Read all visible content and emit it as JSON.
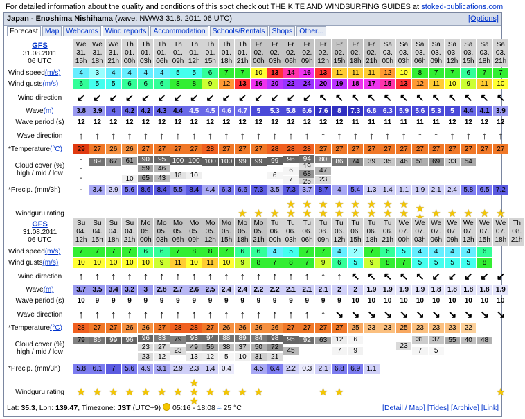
{
  "top_note": {
    "text": "For detailed information about the quality and conditions of this spot check out THE KITE AND WINDSURFING GUIDES at",
    "link": "stoked-publications.com"
  },
  "title": {
    "spot": "Japan - Enoshima Nishihama",
    "wave_info": "(wave: NWW3 31.8. 2011 06 UTC)",
    "options": "[Options]"
  },
  "tabs": [
    "Forecast",
    "Map",
    "Webcams",
    "Wind reports",
    "Accommodation",
    "Schools/Rentals",
    "Shops",
    "Other..."
  ],
  "labels": {
    "model": "GFS",
    "model_date": "31.08.2011",
    "model_time": "06 UTC",
    "wind_speed": "Wind speed",
    "wind_gusts": "Wind gusts",
    "unit_ms": "(m/s)",
    "wind_direction": "Wind direction",
    "wave": "Wave",
    "unit_m": "(m)",
    "wave_period": "Wave period (s)",
    "wave_direction": "Wave direction",
    "temperature": "*Temperature",
    "unit_c": "(°C)",
    "cloud_cover": "Cloud cover (%)",
    "cloud_sub": "high / mid / low",
    "precip": "*Precip. (mm/3h)",
    "windguru": "Windguru rating"
  },
  "colors": {
    "temp_orange": "#f07020",
    "temp_red": "#e04a1a",
    "cloud_grey": "#808080",
    "precip_blue": "#7c7cf0",
    "wave_blue": "#5a5ae0",
    "star": "#f5c700"
  },
  "blocks": [
    {
      "days": [
        "We",
        "We",
        "We",
        "Th",
        "Th",
        "Th",
        "Th",
        "Th",
        "Th",
        "Th",
        "Th",
        "Fr",
        "Fr",
        "Fr",
        "Fr",
        "Fr",
        "Fr",
        "Fr",
        "Fr",
        "Sa",
        "Sa",
        "Sa",
        "Sa",
        "Sa",
        "Sa",
        "Sa",
        "Sa"
      ],
      "dates": [
        "31.",
        "31.",
        "31.",
        "01.",
        "01.",
        "01.",
        "01.",
        "01.",
        "01.",
        "01.",
        "01.",
        "02.",
        "02.",
        "02.",
        "02.",
        "02.",
        "02.",
        "02.",
        "02.",
        "03.",
        "03.",
        "03.",
        "03.",
        "03.",
        "03.",
        "03.",
        "03."
      ],
      "hours": [
        "15h",
        "18h",
        "21h",
        "00h",
        "03h",
        "06h",
        "09h",
        "12h",
        "15h",
        "18h",
        "21h",
        "00h",
        "03h",
        "06h",
        "09h",
        "12h",
        "15h",
        "18h",
        "21h",
        "00h",
        "03h",
        "06h",
        "09h",
        "12h",
        "15h",
        "18h",
        "21h"
      ],
      "wind_speed": [
        4,
        3,
        4,
        4,
        4,
        4,
        5,
        5,
        6,
        7,
        7,
        10,
        13,
        14,
        16,
        13,
        11,
        11,
        11,
        12,
        10,
        8,
        7,
        7,
        6,
        7,
        7
      ],
      "wind_gusts": [
        6,
        5,
        5,
        6,
        6,
        6,
        8,
        8,
        9,
        12,
        13,
        16,
        20,
        22,
        24,
        20,
        19,
        18,
        17,
        15,
        13,
        12,
        11,
        10,
        9,
        11,
        10
      ],
      "wind_dir_arrows": [
        "↙",
        "↙",
        "↙",
        "↙",
        "↙",
        "↙",
        "↙",
        "↙",
        "↙",
        "↙",
        "↙",
        "↙",
        "↙",
        "↙",
        "↙",
        "↖",
        "↖",
        "↖",
        "↖",
        "↖",
        "↖",
        "↖",
        "↖",
        "↖",
        "↖",
        "↖",
        "↖"
      ],
      "wave": [
        3.8,
        3.9,
        4,
        4.2,
        4.2,
        4.3,
        4.4,
        4.5,
        4.5,
        4.6,
        4.7,
        5,
        5.3,
        5.8,
        6.6,
        7.6,
        8,
        7.3,
        6.8,
        6.3,
        5.9,
        5.6,
        5.3,
        5,
        4.4,
        4.1,
        3.9
      ],
      "wave_period": [
        12,
        12,
        12,
        12,
        12,
        12,
        12,
        12,
        12,
        12,
        12,
        12,
        12,
        12,
        12,
        12,
        12,
        11,
        11,
        11,
        11,
        11,
        11,
        12,
        12,
        12,
        12
      ],
      "wave_dir_arrows": [
        "↑",
        "↑",
        "↑",
        "↑",
        "↑",
        "↑",
        "↑",
        "↑",
        "↑",
        "↑",
        "↑",
        "↑",
        "↑",
        "↑",
        "↑",
        "↑",
        "↑",
        "↑",
        "↑",
        "↑",
        "↑",
        "↑",
        "↑",
        "↑",
        "↑",
        "↑",
        "↑"
      ],
      "temperature": [
        29,
        27,
        26,
        26,
        27,
        27,
        27,
        27,
        28,
        27,
        27,
        27,
        28,
        28,
        28,
        27,
        27,
        27,
        27,
        27,
        27,
        27,
        27,
        27,
        27,
        27,
        27
      ],
      "cloud_total": [
        "-",
        "89",
        "67",
        "61",
        "90",
        "95",
        "100",
        "100",
        "100",
        "100",
        "99",
        "99",
        "99",
        "96",
        "94",
        "80",
        "86",
        "74",
        "39",
        "35",
        "46",
        "51",
        "69",
        "33",
        "54"
      ],
      "cloud_hml": [
        [
          "-",
          "-",
          ""
        ],
        [
          "",
          "",
          ""
        ],
        [
          "",
          "",
          ""
        ],
        [
          "",
          "",
          "10"
        ],
        [
          "59",
          "65",
          ""
        ],
        [
          "46",
          "43",
          ""
        ],
        [
          "",
          "18",
          ""
        ],
        [
          "",
          "10",
          ""
        ],
        [
          "",
          "",
          ""
        ],
        [
          "",
          "",
          ""
        ],
        [
          "",
          "",
          ""
        ],
        [
          "",
          "",
          ""
        ],
        [
          "",
          "6",
          ""
        ],
        [
          "",
          "6",
          "7"
        ],
        [
          "19",
          "68",
          "25"
        ],
        [
          "",
          "47",
          "23"
        ],
        [
          "",
          "",
          ""
        ],
        [
          "",
          "",
          ""
        ],
        [
          "",
          "",
          ""
        ],
        [
          "",
          "",
          ""
        ],
        [
          "",
          "",
          ""
        ],
        [
          "",
          "",
          ""
        ],
        [
          "",
          "",
          ""
        ],
        [
          "",
          "",
          ""
        ],
        [
          "",
          "",
          ""
        ],
        [
          "",
          "",
          ""
        ],
        [
          "",
          "",
          ""
        ]
      ],
      "precip": [
        "-",
        3.4,
        2.9,
        5.6,
        8.6,
        8.4,
        5.5,
        8.4,
        4.4,
        6.3,
        6.6,
        7.3,
        3.5,
        7.3,
        3.7,
        8.7,
        4,
        5.4,
        1.3,
        1.4,
        1.1,
        1.9,
        2.1,
        2.4,
        5.8,
        6.5,
        7.2
      ],
      "stars": [
        0,
        0,
        0,
        0,
        0,
        0,
        0,
        0,
        0,
        0,
        1,
        1,
        1,
        3,
        3,
        3,
        3,
        3,
        3,
        3,
        3,
        2,
        1,
        1,
        1,
        1,
        1
      ]
    },
    {
      "days": [
        "Su",
        "Su",
        "Su",
        "Su",
        "Mo",
        "Mo",
        "Mo",
        "Mo",
        "Mo",
        "Mo",
        "Mo",
        "Mo",
        "Tu",
        "Tu",
        "Tu",
        "Tu",
        "Tu",
        "Tu",
        "Tu",
        "Tu",
        "We",
        "We",
        "We",
        "We",
        "We",
        "We",
        "We",
        "Th"
      ],
      "dates": [
        "04.",
        "04.",
        "04.",
        "04.",
        "05.",
        "05.",
        "05.",
        "05.",
        "05.",
        "05.",
        "05.",
        "05.",
        "06.",
        "06.",
        "06.",
        "06.",
        "06.",
        "06.",
        "06.",
        "06.",
        "07.",
        "07.",
        "07.",
        "07.",
        "07.",
        "07.",
        "07.",
        "08."
      ],
      "hours": [
        "12h",
        "15h",
        "18h",
        "21h",
        "00h",
        "03h",
        "06h",
        "09h",
        "12h",
        "15h",
        "18h",
        "21h",
        "00h",
        "03h",
        "06h",
        "09h",
        "12h",
        "15h",
        "18h",
        "21h",
        "00h",
        "03h",
        "06h",
        "09h",
        "12h",
        "15h",
        "18h",
        "21h"
      ],
      "wind_speed": [
        7,
        7,
        7,
        7,
        6,
        6,
        7,
        8,
        8,
        7,
        6,
        6,
        4,
        5,
        7,
        7,
        4,
        2,
        7,
        6,
        5,
        4,
        4,
        4,
        4,
        6
      ],
      "wind_gusts": [
        10,
        10,
        10,
        10,
        10,
        9,
        11,
        10,
        11,
        10,
        9,
        8,
        7,
        8,
        7,
        9,
        6,
        5,
        9,
        8,
        7,
        5,
        5,
        5,
        5,
        8
      ],
      "wind_dir_arrows": [
        "↑",
        "↑",
        "↑",
        "↑",
        "↑",
        "↑",
        "↑",
        "↑",
        "↑",
        "↑",
        "↑",
        "↑",
        "↑",
        "↑",
        "↑",
        "↑",
        "↑",
        "↖",
        "↖",
        "↖",
        "↖",
        "↖",
        "↙",
        "↙",
        "↙",
        "↙",
        "↙"
      ],
      "wave": [
        3.7,
        3.5,
        3.4,
        3.2,
        3,
        2.8,
        2.7,
        2.6,
        2.5,
        2.4,
        2.4,
        2.2,
        2.2,
        2.1,
        2.1,
        2.1,
        2,
        2,
        1.9,
        1.9,
        1.9,
        1.9,
        1.8,
        1.8,
        1.8,
        1.8,
        1.9
      ],
      "wave_period": [
        10,
        9,
        9,
        9,
        9,
        9,
        9,
        9,
        9,
        9,
        9,
        9,
        9,
        9,
        9,
        9,
        9,
        10,
        10,
        10,
        10,
        10,
        10,
        10,
        10,
        10,
        10
      ],
      "wave_dir_arrows": [
        "↑",
        "↑",
        "↑",
        "↑",
        "↑",
        "↑",
        "↑",
        "↑",
        "↑",
        "↑",
        "↑",
        "↑",
        "↑",
        "↑",
        "↑",
        "↑",
        "↘",
        "↘",
        "↘",
        "↘",
        "↘",
        "↘",
        "↘",
        "↘",
        "↘",
        "↘",
        "↘"
      ],
      "temperature": [
        28,
        27,
        27,
        26,
        26,
        27,
        28,
        28,
        27,
        26,
        26,
        26,
        26,
        27,
        27,
        27,
        27,
        25,
        23,
        23,
        25,
        23,
        23,
        23,
        22
      ],
      "cloud_total": [
        "79",
        "86",
        "99",
        "96",
        "96",
        "83",
        "79",
        "93",
        "94",
        "88",
        "89",
        "84",
        "98",
        "95",
        "92",
        "63",
        "12",
        "6",
        "",
        "",
        "",
        "31",
        "37",
        "55",
        "40",
        "48"
      ],
      "cloud_hml": [
        [
          "",
          "",
          ""
        ],
        [
          "",
          "",
          ""
        ],
        [
          "",
          "",
          ""
        ],
        [
          "",
          "",
          ""
        ],
        [
          "23",
          "23",
          ""
        ],
        [
          "27",
          "12",
          ""
        ],
        [
          "23",
          "",
          ""
        ],
        [
          "49",
          "13",
          ""
        ],
        [
          "56",
          "12",
          ""
        ],
        [
          "38",
          "5",
          ""
        ],
        [
          "37",
          "10",
          ""
        ],
        [
          "50",
          "31",
          ""
        ],
        [
          "72",
          "21",
          ""
        ],
        [
          "45",
          "",
          ""
        ],
        [
          "",
          "",
          ""
        ],
        [
          "",
          "",
          ""
        ],
        [
          "7",
          "",
          ""
        ],
        [
          "9",
          "",
          ""
        ],
        [
          "",
          "",
          ""
        ],
        [
          "",
          "",
          ""
        ],
        [
          "23",
          "",
          ""
        ],
        [
          "7",
          "",
          ""
        ],
        [
          "5",
          "",
          ""
        ],
        [
          "",
          "",
          ""
        ],
        [
          "",
          "",
          ""
        ],
        [
          "",
          "",
          ""
        ],
        [
          "",
          "",
          "7"
        ]
      ],
      "precip": [
        5.8,
        6.1,
        7,
        5.6,
        4.9,
        3.1,
        2.9,
        2.3,
        1.4,
        0.4,
        "",
        4.5,
        6.4,
        2.2,
        0.3,
        2.1,
        6.8,
        6.9,
        1.1,
        "",
        "",
        "",
        "",
        "",
        "",
        ""
      ],
      "stars": [
        1,
        1,
        1,
        1,
        1,
        1,
        1,
        3,
        1,
        1,
        1,
        1,
        0,
        0,
        0,
        1,
        1,
        0,
        0,
        0,
        0,
        0,
        0,
        0,
        0,
        0,
        1
      ]
    }
  ],
  "footer": {
    "lat_label": "Lat:",
    "lat": "35.3",
    "lon_label": "Lon:",
    "lon": "139.47",
    "tz_label": "Timezone:",
    "tz": "JST",
    "utc": "(UTC+9)",
    "sun": "05:16 - 18:08",
    "sea_temp": "25 °C",
    "links": [
      "[Detail / Map]",
      "[Tides]",
      "[Archive]",
      "[Link]"
    ]
  }
}
